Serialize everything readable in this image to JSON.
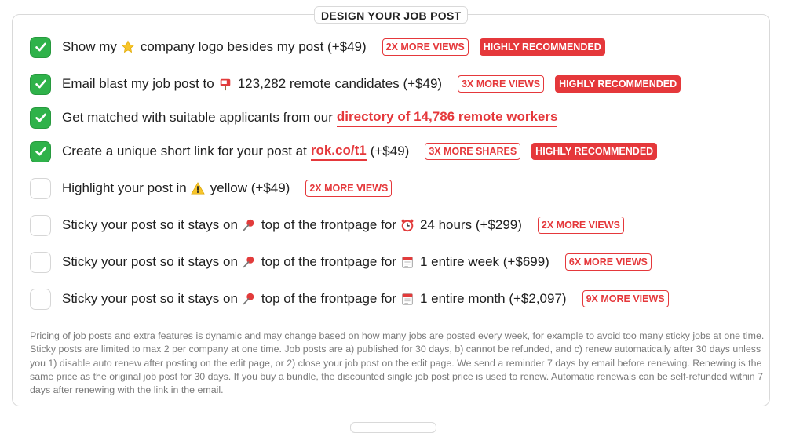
{
  "section": {
    "title": "DESIGN YOUR JOB POST"
  },
  "options": [
    {
      "checked": true,
      "pre": "Show my",
      "icon": "star-icon",
      "post": "company logo besides my post (+$49)",
      "tag": "2X MORE VIEWS",
      "rec": "HIGHLY RECOMMENDED"
    },
    {
      "checked": true,
      "pre": "Email blast my job post to",
      "icon": "mailbox-icon",
      "post": "123,282 remote candidates (+$49)",
      "tag": "3X MORE VIEWS",
      "rec": "HIGHLY RECOMMENDED"
    },
    {
      "checked": true,
      "pre": "Get matched with suitable applicants from our",
      "link": "directory of 14,786 remote workers"
    },
    {
      "checked": true,
      "pre": "Create a unique short link for your post at",
      "link": "rok.co/t1",
      "post": "(+$49)",
      "tag": "3X MORE SHARES",
      "rec": "HIGHLY RECOMMENDED"
    },
    {
      "checked": false,
      "pre": "Highlight your post in",
      "icon": "warning-icon",
      "post": "yellow (+$49)",
      "tag": "2X MORE VIEWS"
    },
    {
      "checked": false,
      "pre": "Sticky your post so it stays on",
      "icon": "pushpin-icon",
      "mid": "top of the frontpage for",
      "icon2": "alarm-clock-icon",
      "post": "24 hours (+$299)",
      "tag": "2X MORE VIEWS"
    },
    {
      "checked": false,
      "pre": "Sticky your post so it stays on",
      "icon": "pushpin-icon",
      "mid": "top of the frontpage for",
      "icon2": "calendar-icon",
      "post": "1 entire week (+$699)",
      "tag": "6X MORE VIEWS"
    },
    {
      "checked": false,
      "pre": "Sticky your post so it stays on",
      "icon": "pushpin-icon",
      "mid": "top of the frontpage for",
      "icon2": "calendar-icon",
      "post": "1 entire month (+$2,097)",
      "tag": "9X MORE VIEWS"
    }
  ],
  "note": "Pricing of job posts and extra features is dynamic and may change based on how many jobs are posted every week, for example to avoid too many sticky jobs at one time. Sticky posts are limited to max 2 per company at one time. Job posts are a) published for 30 days, b) cannot be refunded, and c) renew automatically after 30 days unless you 1) disable auto renew after posting on the edit page, or 2) close your job post on the edit page. We send a reminder 7 days by email before renewing. Renewing is the same price as the original job post for 30 days. If you buy a bundle, the discounted single job post price is used to renew. Automatic renewals can be self-refunded within 7 days after renewing with the link in the email.",
  "colors": {
    "accent": "#e5383b",
    "check": "#2fb24a"
  }
}
